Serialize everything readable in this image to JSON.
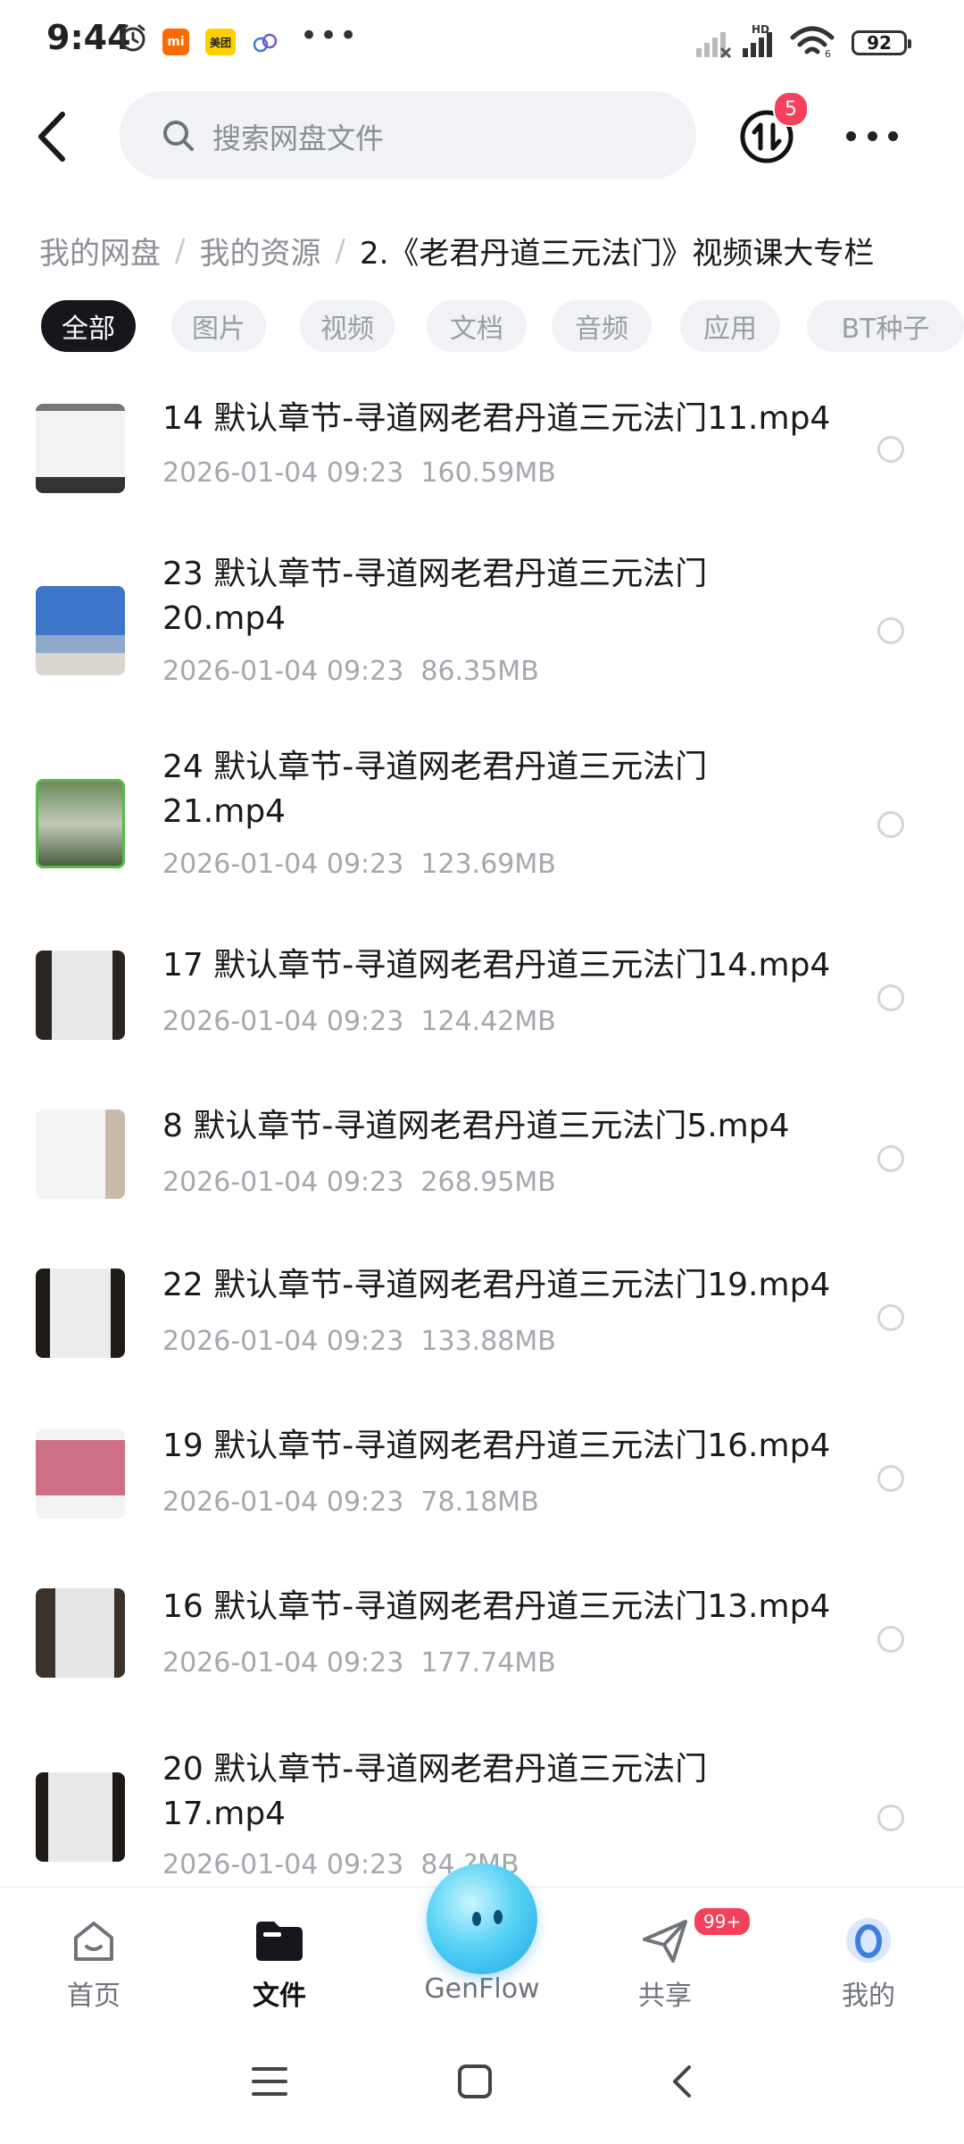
{
  "status_bar": {
    "time": "9:44",
    "app_chips": [
      "mi",
      "美团"
    ],
    "hd": "HD",
    "battery": "92"
  },
  "header": {
    "search_placeholder": "搜索网盘文件",
    "transfer_badge": "5"
  },
  "breadcrumb": [
    {
      "label": "我的网盘"
    },
    {
      "label": "我的资源"
    },
    {
      "label": "2.《老君丹道三元法门》视频课大专栏"
    }
  ],
  "filters": [
    {
      "label": "全部",
      "active": true
    },
    {
      "label": "图片",
      "active": false
    },
    {
      "label": "视频",
      "active": false
    },
    {
      "label": "文档",
      "active": false
    },
    {
      "label": "音频",
      "active": false
    },
    {
      "label": "应用",
      "active": false
    },
    {
      "label": "BT种子",
      "active": false
    }
  ],
  "files": [
    {
      "name": "14 默认章节-寻道网老君丹道三元法门11.mp4",
      "date": "2026-01-04  09:23",
      "size": "160.59MB"
    },
    {
      "name": "23 默认章节-寻道网老君丹道三元法门\n20.mp4",
      "date": "2026-01-04  09:23",
      "size": "86.35MB"
    },
    {
      "name": "24 默认章节-寻道网老君丹道三元法门\n21.mp4",
      "date": "2026-01-04  09:23",
      "size": "123.69MB"
    },
    {
      "name": "17 默认章节-寻道网老君丹道三元法门14.mp4",
      "date": "2026-01-04  09:23",
      "size": "124.42MB"
    },
    {
      "name": "8 默认章节-寻道网老君丹道三元法门5.mp4",
      "date": "2026-01-04  09:23",
      "size": "268.95MB"
    },
    {
      "name": "22 默认章节-寻道网老君丹道三元法门19.mp4",
      "date": "2026-01-04  09:23",
      "size": "133.88MB"
    },
    {
      "name": "19 默认章节-寻道网老君丹道三元法门16.mp4",
      "date": "2026-01-04  09:23",
      "size": "78.18MB"
    },
    {
      "name": "16 默认章节-寻道网老君丹道三元法门13.mp4",
      "date": "2026-01-04  09:23",
      "size": "177.74MB"
    },
    {
      "name": "20 默认章节-寻道网老君丹道三元法门\n17.mp4",
      "date": "2026-01-04  09:23",
      "size": "84.?MB"
    }
  ],
  "bottom_nav": [
    {
      "label": "首页",
      "icon": "home-icon",
      "active": false
    },
    {
      "label": "文件",
      "icon": "folder-icon",
      "active": true
    },
    {
      "label": "GenFlow",
      "icon": "genflow-orb-icon",
      "active": false
    },
    {
      "label": "共享",
      "icon": "send-icon",
      "active": false,
      "badge": "99+"
    },
    {
      "label": "我的",
      "icon": "profile-icon",
      "active": false
    }
  ],
  "colors": {
    "accent_dark": "#15171c",
    "badge_red": "#f4405a",
    "muted_text": "#a4a7ad",
    "genflow_blue": "#1aa7e6"
  }
}
